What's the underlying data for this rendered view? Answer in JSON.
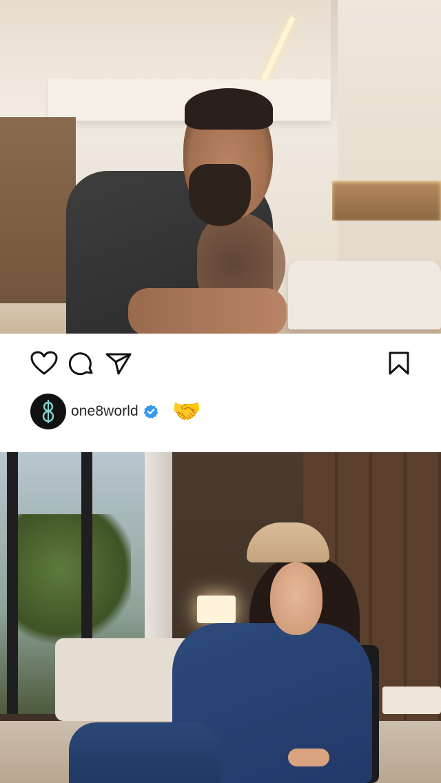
{
  "post": {
    "author": {
      "username": "one8world",
      "verified": true,
      "avatar_mark": "8"
    },
    "reaction_emoji": "🤝",
    "actions": {
      "like_icon": "heart-icon",
      "comment_icon": "comment-icon",
      "share_icon": "paper-plane-icon",
      "save_icon": "bookmark-icon"
    }
  },
  "colors": {
    "verified_badge": "#3897f0",
    "text_primary": "#262626",
    "avatar_bg": "#111111",
    "avatar_mark": "#7fd6d0"
  }
}
